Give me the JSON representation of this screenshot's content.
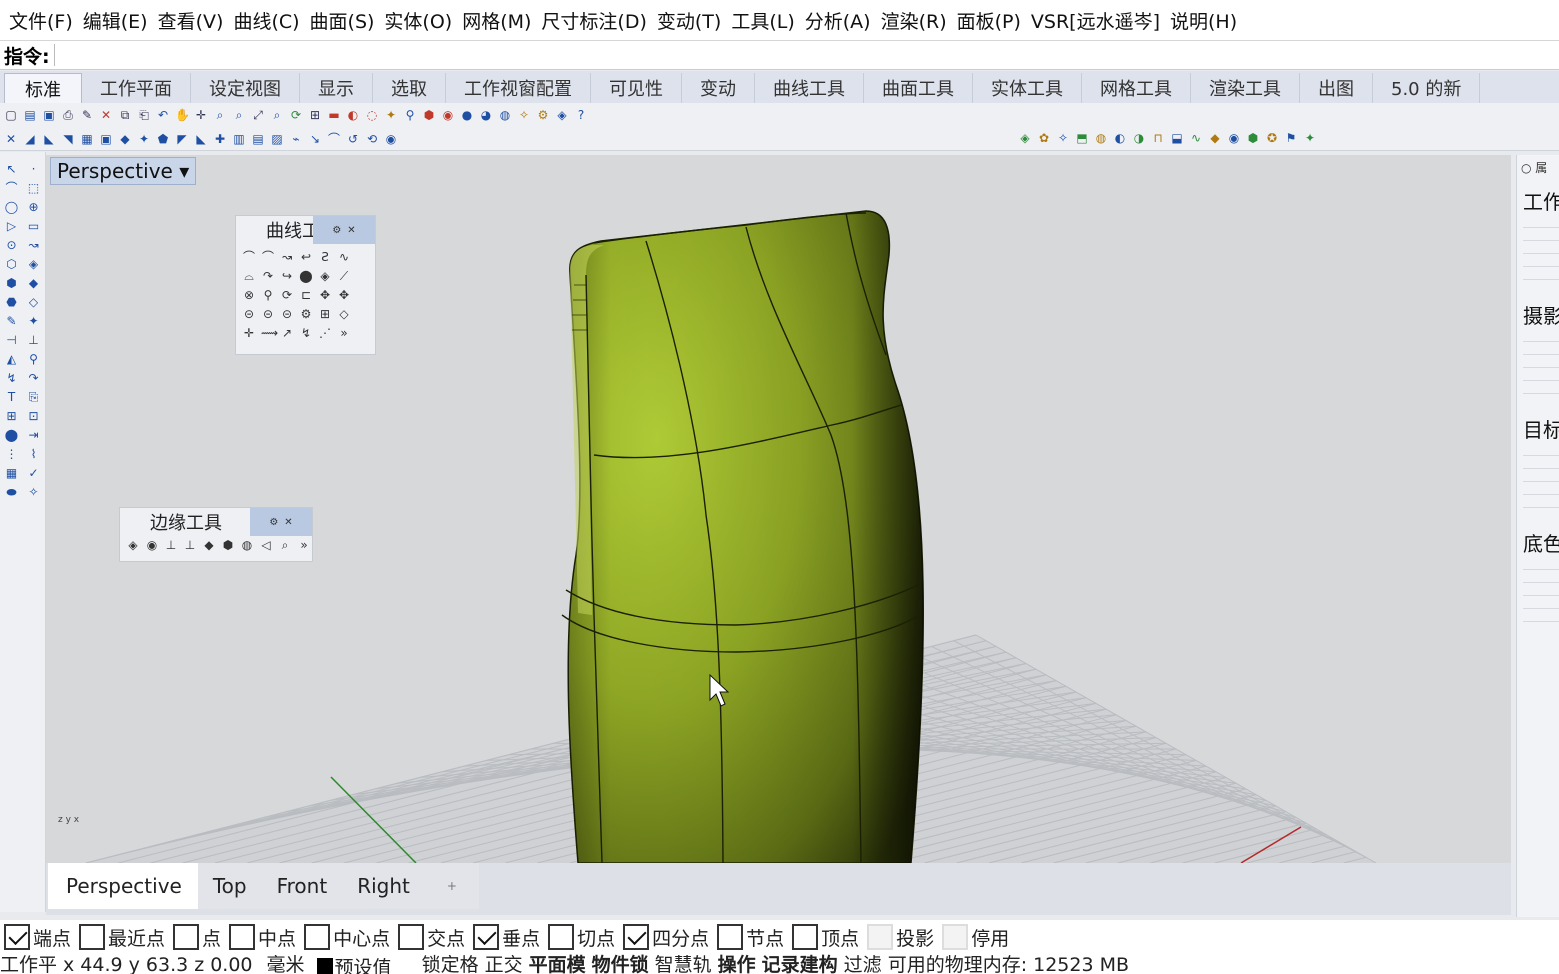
{
  "menu": [
    "文件(F)",
    "编辑(E)",
    "查看(V)",
    "曲线(C)",
    "曲面(S)",
    "实体(O)",
    "网格(M)",
    "尺寸标注(D)",
    "变动(T)",
    "工具(L)",
    "分析(A)",
    "渲染(R)",
    "面板(P)",
    "VSR[远水遥岑]",
    "说明(H)"
  ],
  "command": {
    "label": "指令:"
  },
  "tabs": [
    "标准",
    "工作平面",
    "设定视图",
    "显示",
    "选取",
    "工作视窗配置",
    "可见性",
    "变动",
    "曲线工具",
    "曲面工具",
    "实体工具",
    "网格工具",
    "渲染工具",
    "出图",
    "5.0 的新"
  ],
  "viewport": {
    "title": "Perspective",
    "axis": "z y x"
  },
  "panels": {
    "curve_tools": {
      "title": "曲线工"
    },
    "edge_tools": {
      "title": "边缘工具"
    }
  },
  "right_panel": {
    "head": "○ 属",
    "sections": [
      "工作",
      "摄影",
      "目标",
      "底色"
    ]
  },
  "viewport_tabs": [
    "Perspective",
    "Top",
    "Front",
    "Right",
    "+"
  ],
  "osnaps": [
    {
      "label": "端点",
      "checked": true
    },
    {
      "label": "最近点",
      "checked": false
    },
    {
      "label": "点",
      "checked": false
    },
    {
      "label": "中点",
      "checked": false
    },
    {
      "label": "中心点",
      "checked": false
    },
    {
      "label": "交点",
      "checked": false
    },
    {
      "label": "垂点",
      "checked": true
    },
    {
      "label": "切点",
      "checked": false
    },
    {
      "label": "四分点",
      "checked": true
    },
    {
      "label": "节点",
      "checked": false
    },
    {
      "label": "顶点",
      "checked": false
    },
    {
      "label": "投影",
      "checked": false,
      "disabled": true
    },
    {
      "label": "停用",
      "checked": false,
      "disabled": true
    }
  ],
  "status": {
    "cplane": "工作平",
    "x": "x 44.9",
    "y": "y 63.3",
    "z": "z 0.00",
    "unit": "毫米",
    "layer": "预设值",
    "lock_grid": "锁定格",
    "ortho": "正交",
    "planar": "平面模",
    "osnap": "物件锁",
    "smarttrack": "智慧轨",
    "gumball": "操作",
    "history": "记录建构",
    "filter": "过滤",
    "memory": "可用的物理内存: 12523 MB"
  },
  "colors": {
    "model": "#8ea624",
    "viewport_bg": "#d6d8da",
    "active_tab": "#f3f5fa"
  }
}
